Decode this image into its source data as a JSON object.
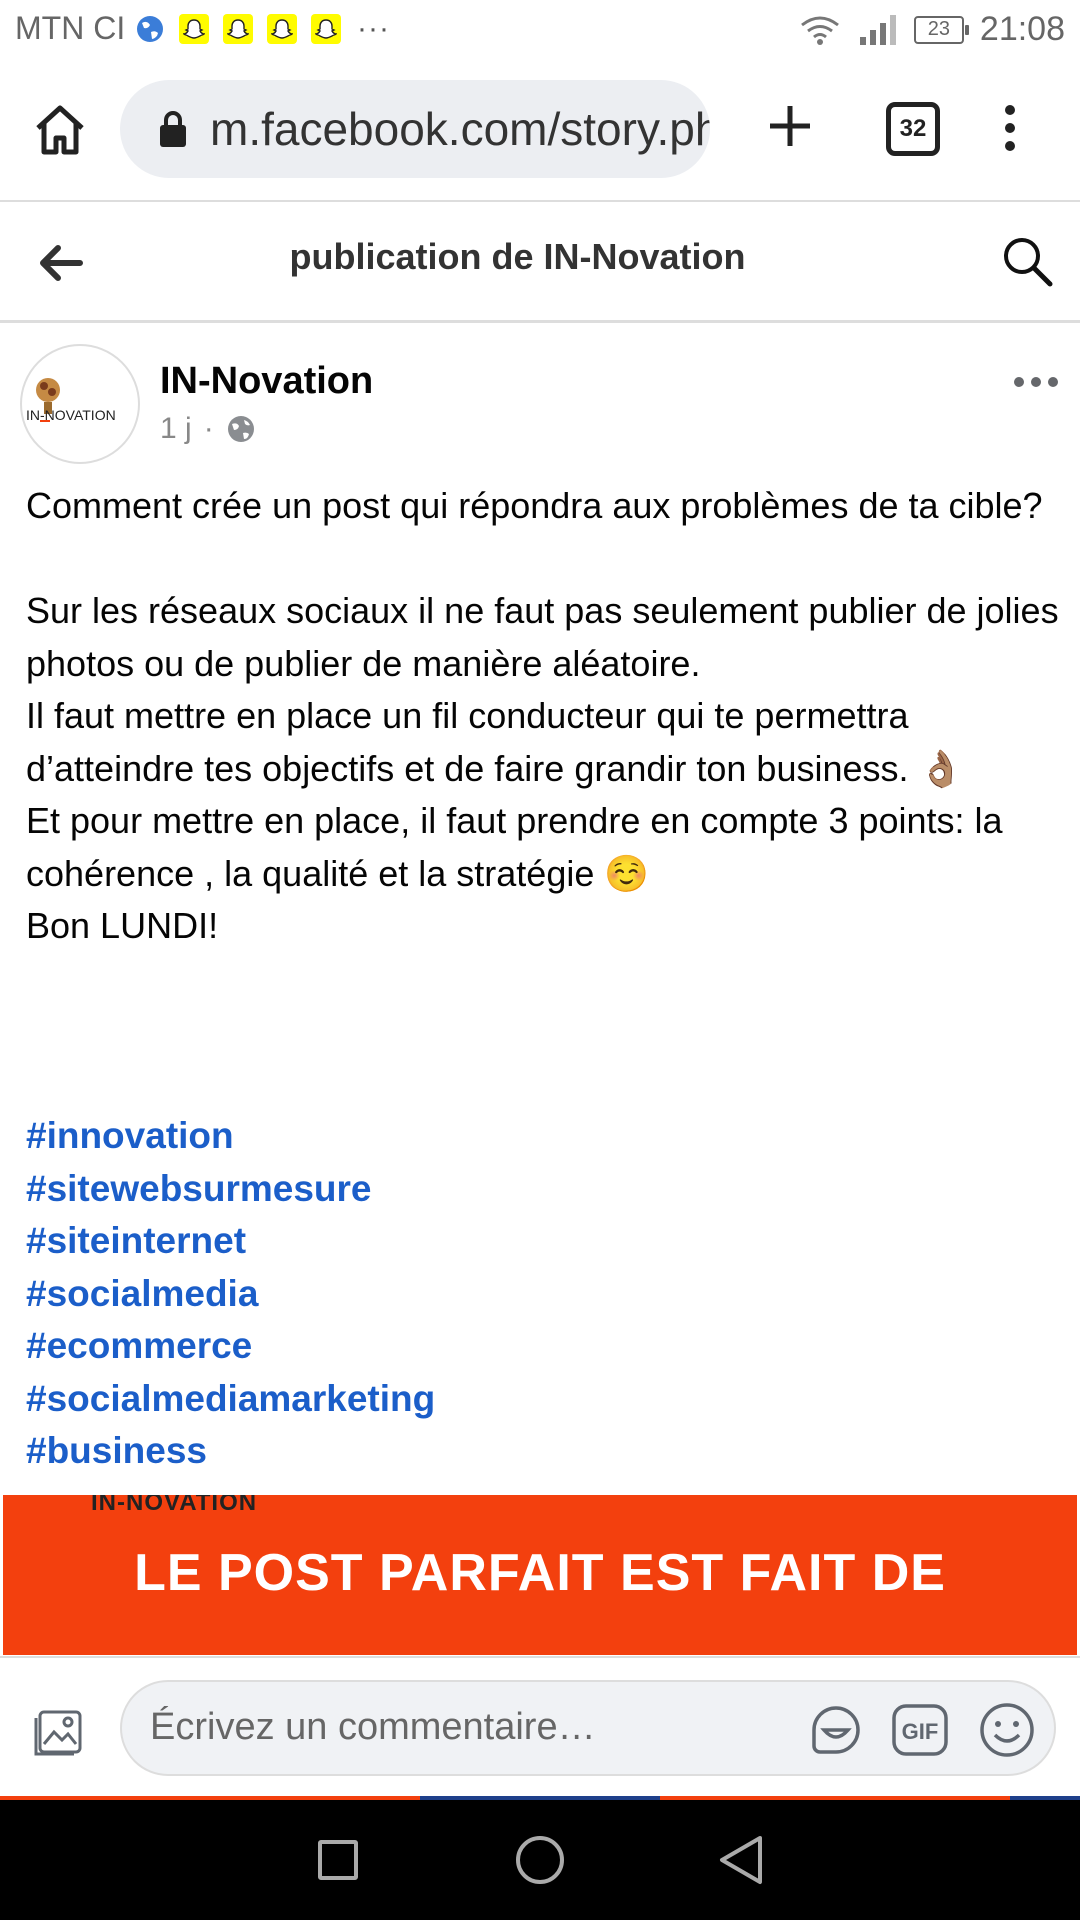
{
  "status_bar": {
    "carrier": "MTN CI",
    "overflow": "···",
    "battery": "23",
    "time": "21:08"
  },
  "browser": {
    "url": "m.facebook.com/story.php",
    "tab_count": "32"
  },
  "header": {
    "title": "publication de IN-Novation"
  },
  "post": {
    "author": "IN-Novation",
    "avatar_logo_text": "IN-NOVATION",
    "time": "1 j",
    "separator": "·",
    "paragraphs": [
      "Comment crée un post qui répondra aux problèmes de ta cible?",
      "",
      "Sur les réseaux sociaux il ne faut pas seulement publier de jolies photos ou de publier de manière aléatoire.",
      "Il faut mettre en place un fil conducteur qui te permettra d’atteindre tes objectifs et de faire grandir ton business. 👌🏽",
      "Et pour mettre en place, il faut prendre en compte 3 points: la cohérence , la qualité et la stratégie ☺️",
      "Bon LUNDI!"
    ],
    "hashtags": [
      "#innovation",
      "#sitewebsurmesure",
      "#siteinternet",
      "#socialmedia",
      "#ecommerce",
      "#socialmediamarketing",
      "#business"
    ],
    "image": {
      "logo_text": "IN-NOVATION",
      "headline": "LE POST PARFAIT EST FAIT DE",
      "background_color": "#f3400e"
    }
  },
  "comment": {
    "placeholder": "Écrivez un commentaire…",
    "gif_label": "GIF"
  },
  "colors": {
    "hashtag": "#1b5ec9",
    "banner": "#f3400e"
  }
}
